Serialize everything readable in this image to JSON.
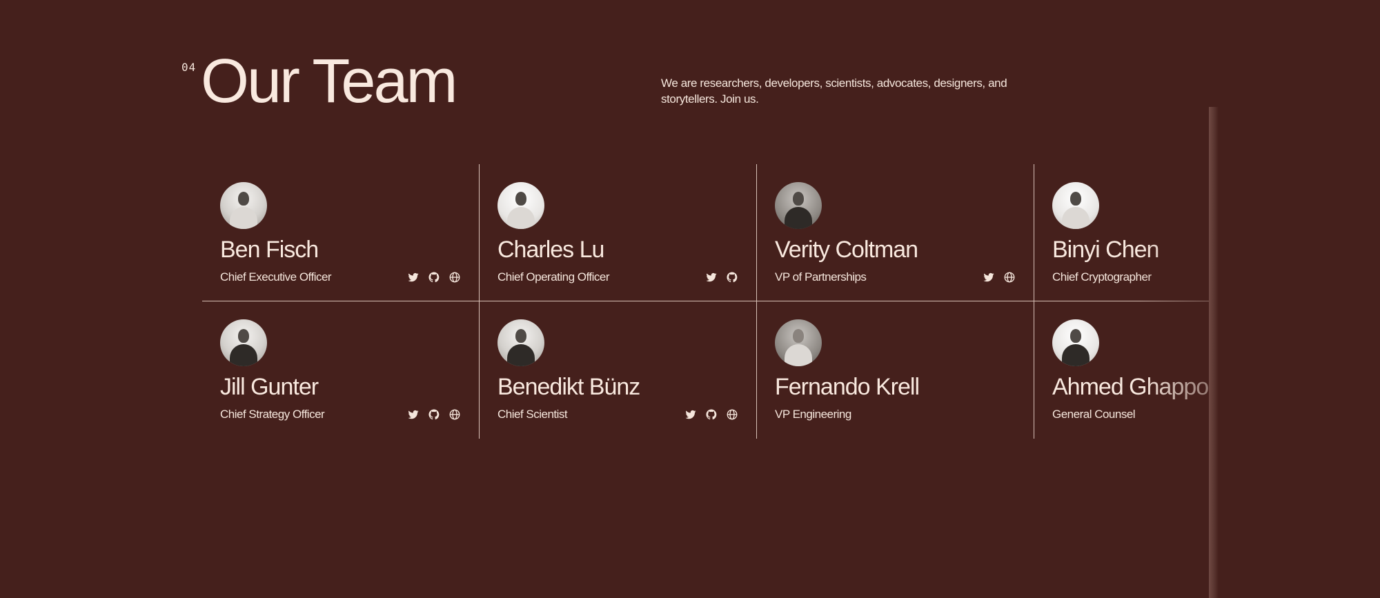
{
  "header": {
    "section_number": "04",
    "title": "Our Team",
    "intro": "We are researchers, developers, scientists, advocates, designers, and storytellers. Join us."
  },
  "colors": {
    "background": "#45201c",
    "text": "#f5e6dc",
    "divider": "#d9c2b8"
  },
  "team": [
    {
      "name": "Ben Fisch",
      "role": "Chief Executive Officer",
      "socials": [
        "twitter-icon",
        "github-icon",
        "globe-icon"
      ]
    },
    {
      "name": "Charles Lu",
      "role": "Chief Operating Officer",
      "socials": [
        "twitter-icon",
        "github-icon"
      ]
    },
    {
      "name": "Verity Coltman",
      "role": "VP of Partnerships",
      "socials": [
        "twitter-icon",
        "globe-icon"
      ]
    },
    {
      "name": "Binyi Chen",
      "role": "Chief Cryptographer",
      "socials": []
    },
    {
      "name": "Jill Gunter",
      "role": "Chief Strategy Officer",
      "socials": [
        "twitter-icon",
        "github-icon",
        "globe-icon"
      ]
    },
    {
      "name": "Benedikt Bünz",
      "role": "Chief Scientist",
      "socials": [
        "twitter-icon",
        "github-icon",
        "globe-icon"
      ]
    },
    {
      "name": "Fernando Krell",
      "role": "VP Engineering",
      "socials": []
    },
    {
      "name": "Ahmed Ghappour",
      "role": "General Counsel",
      "socials": []
    }
  ]
}
